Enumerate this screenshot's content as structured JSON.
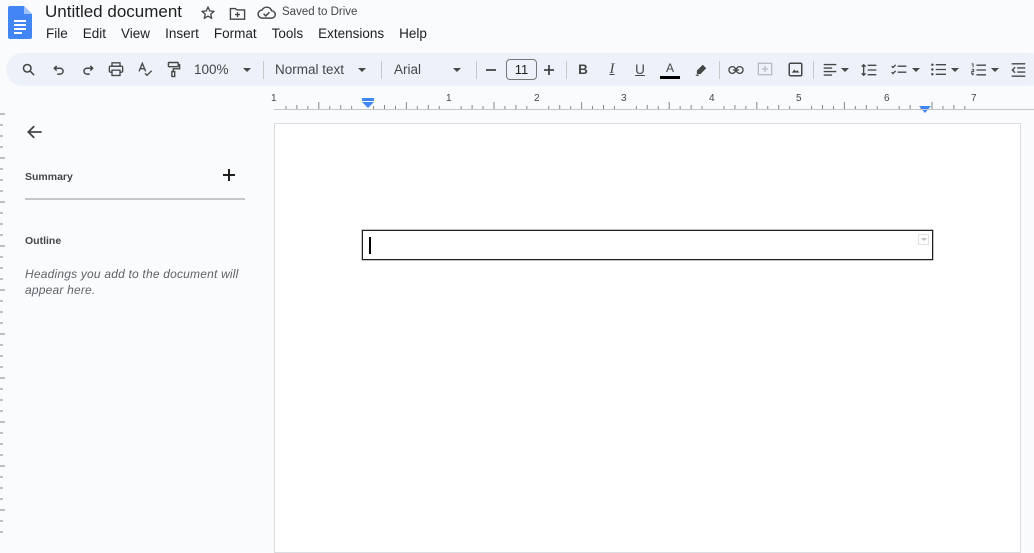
{
  "header": {
    "title": "Untitled document",
    "save_status": "Saved to Drive",
    "icons": [
      "docs-logo-icon",
      "star-icon",
      "move-to-folder-icon",
      "cloud-saved-icon"
    ]
  },
  "menu": [
    "File",
    "Edit",
    "View",
    "Insert",
    "Format",
    "Tools",
    "Extensions",
    "Help"
  ],
  "toolbar": {
    "zoom": "100%",
    "style": "Normal text",
    "font": "Arial",
    "font_size": "11",
    "bold": "B",
    "italic": "I",
    "underline": "U",
    "text_color": "A",
    "text_color_value": "#000000",
    "icons": [
      "search-icon",
      "undo-icon",
      "redo-icon",
      "print-icon",
      "spellcheck-icon",
      "paint-format-icon",
      "decrease-font-icon",
      "increase-font-icon",
      "highlight-icon",
      "link-icon",
      "add-comment-icon",
      "insert-image-icon",
      "align-left-icon",
      "line-spacing-icon",
      "checklist-icon",
      "bulleted-list-icon",
      "numbered-list-icon",
      "decrease-indent-icon"
    ]
  },
  "ruler": {
    "labels": [
      "1",
      "1",
      "2",
      "3",
      "4",
      "5",
      "6",
      "7"
    ]
  },
  "sidebar": {
    "summary_label": "Summary",
    "outline_label": "Outline",
    "outline_empty": "Headings you add to the document will appear here."
  },
  "document": {
    "text_box_value": ""
  },
  "colors": {
    "accent": "#0b57d0",
    "docs_blue": "#4285f4",
    "toolbar_bg": "#edf2fa",
    "page_bg": "#f9fbfd"
  }
}
